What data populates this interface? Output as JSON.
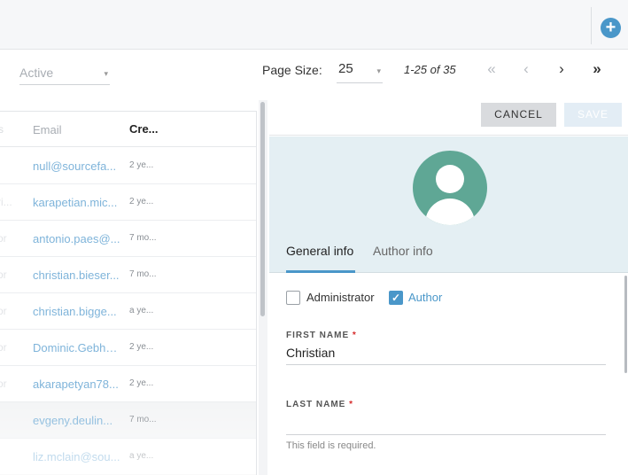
{
  "topbar": {
    "add_icon": "plus-circle-icon",
    "add_symbol": "+"
  },
  "filter": {
    "status_value": "Active",
    "caret": "▾"
  },
  "pagination": {
    "page_size_label": "Page Size:",
    "page_size_value": "25",
    "caret": "▾",
    "range_text": "1-25 of 35",
    "first": "«",
    "prev": "‹",
    "next": "›",
    "last": "»"
  },
  "table": {
    "columns": {
      "prev": "s",
      "email": "Email",
      "created": "Cre..."
    },
    "rows": [
      {
        "prev": "",
        "email": "null@sourcefa...",
        "created": "2 ye..."
      },
      {
        "prev": "ri...",
        "email": "karapetian.mic...",
        "created": "2 ye..."
      },
      {
        "prev": "or",
        "email": "antonio.paes@...",
        "created": "7 mo..."
      },
      {
        "prev": "or",
        "email": "christian.bieser...",
        "created": "7 mo..."
      },
      {
        "prev": "or",
        "email": "christian.bigge...",
        "created": "a ye..."
      },
      {
        "prev": "or",
        "email": "Dominic.Gebha...",
        "created": "2 ye..."
      },
      {
        "prev": "or",
        "email": "akarapetyan78...",
        "created": "2 ye..."
      },
      {
        "prev": "",
        "email": "evgeny.deulin...",
        "created": "7 mo..."
      },
      {
        "prev": "",
        "email": "liz.mclain@sou...",
        "created": "a ye..."
      }
    ]
  },
  "detail": {
    "cancel_label": "CANCEL",
    "save_label": "SAVE",
    "tabs": {
      "general": "General info",
      "author": "Author info"
    },
    "checkboxes": {
      "admin_label": "Administrator",
      "author_label": "Author",
      "check_mark": "✓"
    },
    "first_name": {
      "label": "FIRST NAME",
      "required_mark": "*",
      "value": "Christian"
    },
    "last_name": {
      "label": "LAST NAME",
      "required_mark": "*",
      "value": "",
      "error": "This field is required."
    }
  },
  "colors": {
    "accent": "#4a97c9",
    "avatar": "#5fa795",
    "profile_band": "#e4eff3",
    "required": "#d62a2a"
  }
}
